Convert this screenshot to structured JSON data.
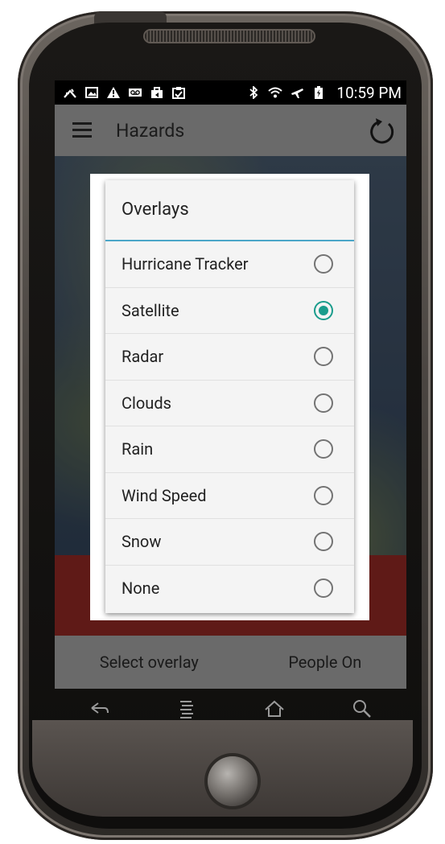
{
  "status_bar": {
    "time": "10:59 PM",
    "icons_left": [
      "bike-icon",
      "image-icon",
      "warning-icon",
      "voicemail-icon",
      "shop-bag-icon",
      "clipboard-check-icon"
    ],
    "icons_right": [
      "bluetooth-icon",
      "wifi-icon",
      "airplane-icon",
      "battery-icon"
    ]
  },
  "app_bar": {
    "title": "Hazards",
    "menu_icon": "menu-icon",
    "refresh_icon": "refresh-icon"
  },
  "dialog": {
    "title": "Overlays",
    "accent_color": "#1a9c8c",
    "divider_color": "#4aa6c8",
    "options": [
      {
        "label": "Hurricane Tracker",
        "selected": false
      },
      {
        "label": "Satellite",
        "selected": true
      },
      {
        "label": "Radar",
        "selected": false
      },
      {
        "label": "Clouds",
        "selected": false
      },
      {
        "label": "Rain",
        "selected": false
      },
      {
        "label": "Wind Speed",
        "selected": false
      },
      {
        "label": "Snow",
        "selected": false
      },
      {
        "label": "None",
        "selected": false
      }
    ]
  },
  "bottom_bar": {
    "select_overlay": "Select overlay",
    "people_toggle": "People On"
  },
  "nav_keys": [
    "back-icon",
    "menu-lines-icon",
    "home-icon",
    "search-icon"
  ]
}
